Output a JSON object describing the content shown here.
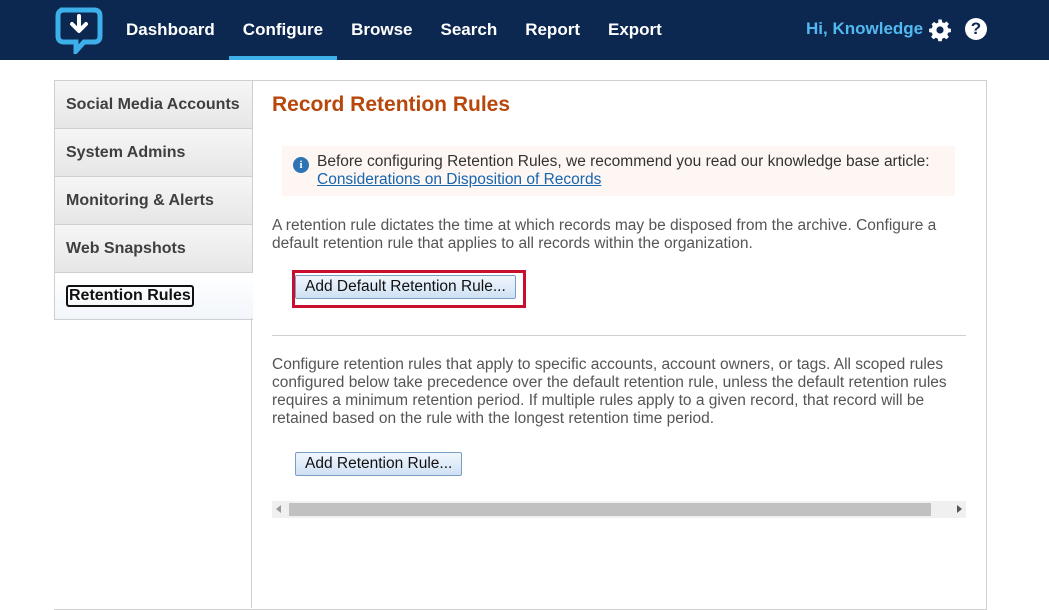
{
  "header": {
    "logo_icon": "chat-download-logo-icon",
    "nav": [
      {
        "label": "Dashboard"
      },
      {
        "label": "Configure"
      },
      {
        "label": "Browse"
      },
      {
        "label": "Search"
      },
      {
        "label": "Report"
      },
      {
        "label": "Export"
      }
    ],
    "active_nav": "Configure",
    "greeting": "Hi, Knowledge",
    "settings_icon": "gear-icon",
    "help_glyph": "?",
    "colors": {
      "bar": "#0c2750",
      "accent": "#3db0ea"
    }
  },
  "sidebar": {
    "items": [
      {
        "label": "Social Media Accounts"
      },
      {
        "label": "System Admins"
      },
      {
        "label": "Monitoring & Alerts"
      },
      {
        "label": "Web Snapshots"
      },
      {
        "label": "Retention Rules"
      }
    ],
    "active": "Retention Rules"
  },
  "main": {
    "title": "Record Retention Rules",
    "info": {
      "icon": "info-icon",
      "text": "Before configuring Retention Rules, we recommend you read our knowledge base article: ",
      "link": "Considerations on Disposition of Records"
    },
    "default_desc": "A retention rule dictates the time at which records may be disposed from the archive. Configure a default retention rule that applies to all records within the organization.",
    "default_button": "Add Default Retention Rule...",
    "scoped_desc": "Configure retention rules that apply to specific accounts, account owners, or tags. All scoped rules configured below take precedence over the default retention rule, unless the default retention rules requires a minimum retention period. If multiple rules apply to a given record, that record will be retained based on the rule with the longest retention time period.",
    "add_button": "Add Retention Rule..."
  }
}
